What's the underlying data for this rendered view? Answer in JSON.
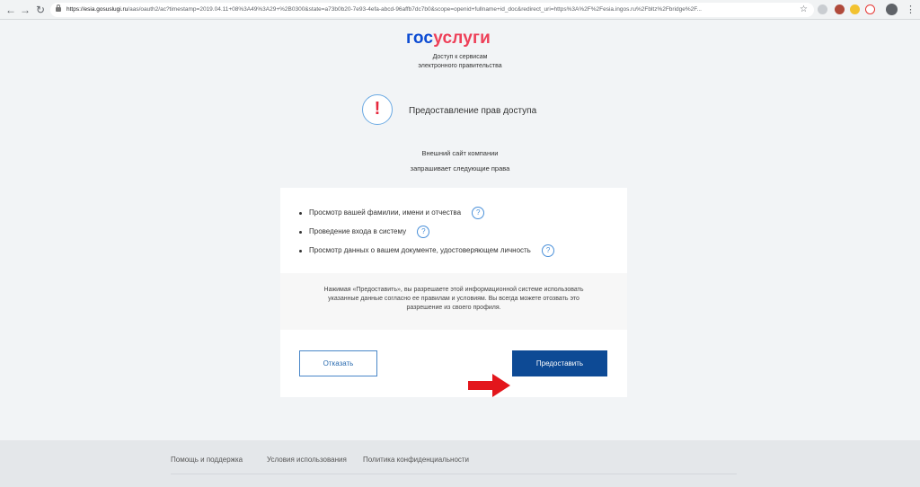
{
  "browser": {
    "url_host": "https://esia.gosuslugi.ru",
    "url_rest": "/aas/oauth2/ac?timestamp=2019.04.11+08%3A49%3A29+%2B0300&state=a73b0b20-7e93-4efa-abcd-96affb7dc7b0&scope=openid+fullname+id_doc&redirect_uri=https%3A%2F%2Fesia.ingos.ru%2Fbltz%2Fbridge%2F...",
    "icons": [
      "back-icon",
      "forward-icon",
      "reload-icon",
      "lock-icon",
      "star-icon",
      "profile-icon",
      "menu-icon"
    ]
  },
  "logo": {
    "part1": "гос",
    "part2": "услуги"
  },
  "subtitle": {
    "line1": "Доступ к сервисам",
    "line2": "электронного правительства"
  },
  "heading": "Предоставление прав доступа",
  "warning_symbol": "!",
  "intro": {
    "line1": "Внешний сайт компании",
    "line2": "запрашивает следующие права"
  },
  "permissions": [
    "Просмотр вашей фамилии, имени и отчества",
    "Проведение входа в систему",
    "Просмотр данных о вашем документе, удостоверяющем личность"
  ],
  "help_symbol": "?",
  "consent": {
    "line1": "Нажимая «Предоставить», вы разрешаете этой информационной системе использовать",
    "line2": "указанные данные согласно ее правилам и условиям. Вы всегда можете отозвать это",
    "line3": "разрешение из своего профиля."
  },
  "buttons": {
    "refuse": "Отказать",
    "grant": "Предоставить"
  },
  "footer": {
    "links": [
      "Помощь и поддержка",
      "Условия использования",
      "Политика конфиденциальности"
    ]
  },
  "colors": {
    "brand_blue": "#0d4cd3",
    "brand_red": "#ee3f58",
    "button_blue": "#0d4a95",
    "arrow_red": "#e3161c"
  }
}
